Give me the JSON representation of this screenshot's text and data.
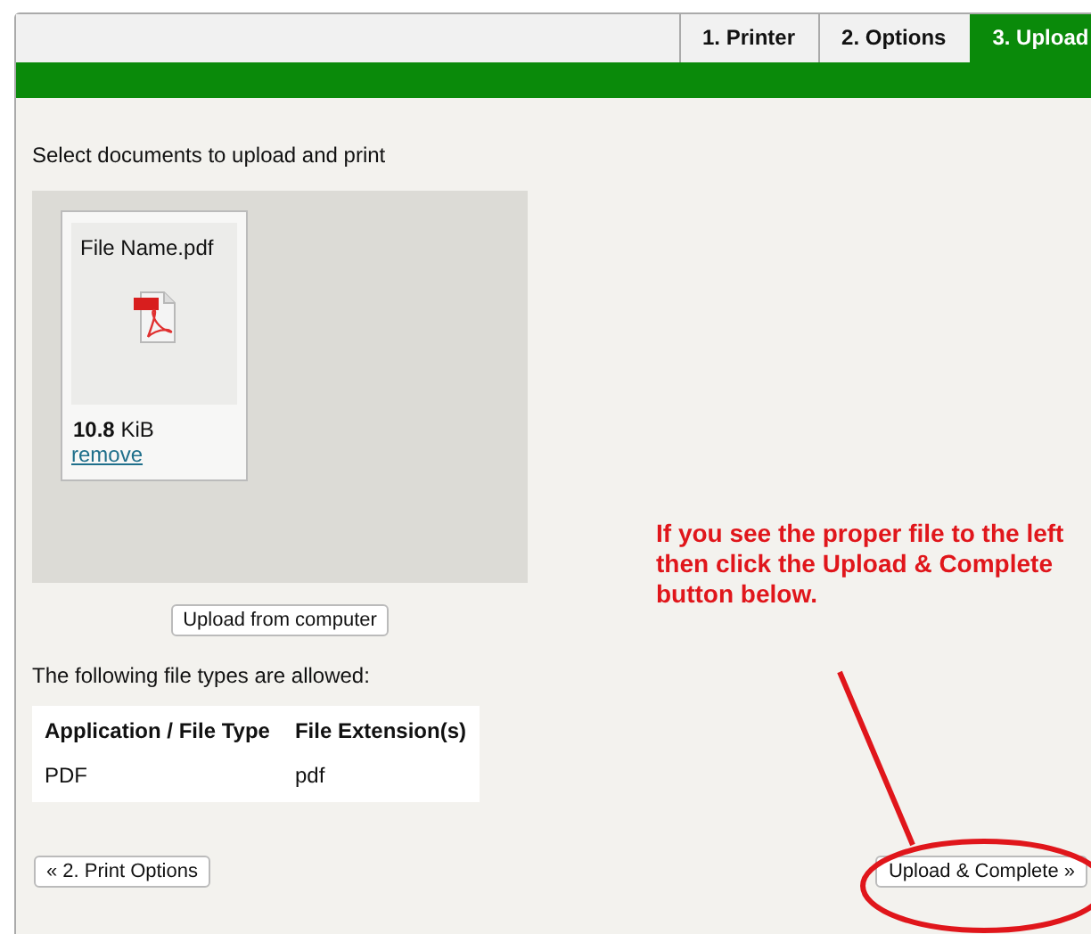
{
  "tabs": [
    {
      "label": "1. Printer",
      "selected": false
    },
    {
      "label": "2. Options",
      "selected": false
    },
    {
      "label": "3. Upload",
      "selected": true
    }
  ],
  "intro": "Select documents to upload and print",
  "files": [
    {
      "name": "File Name.pdf",
      "size_value": "10.8",
      "size_unit": "KiB",
      "remove": "remove"
    }
  ],
  "upload_button": "Upload from computer",
  "allowed_text": "The following file types are allowed:",
  "table": {
    "columns": [
      "Application / File Type",
      "File Extension(s)"
    ],
    "rows": [
      [
        "PDF",
        "pdf"
      ]
    ]
  },
  "note": "If you see the proper file to the left then click the Upload & Complete button below.",
  "back_button": "« 2. Print Options",
  "complete_button": "Upload & Complete »"
}
